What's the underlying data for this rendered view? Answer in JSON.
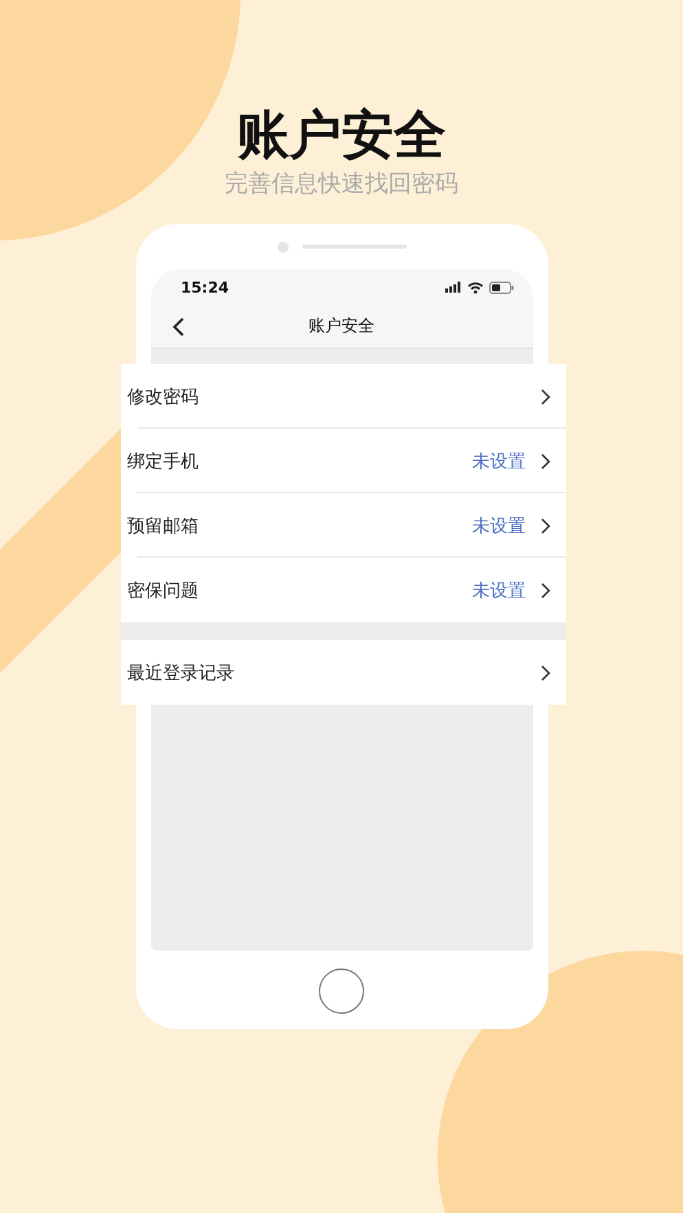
{
  "headline": "账户安全",
  "subheadline": "完善信息快速找回密码",
  "phone": {
    "status_bar": {
      "time": "15:24"
    },
    "nav_bar": {
      "title": "账户安全"
    },
    "setting_groups": [
      {
        "rows": [
          {
            "label": "修改密码"
          },
          {
            "label": "绑定手机",
            "value": "未设置"
          },
          {
            "label": "预留邮箱",
            "value": "未设置"
          },
          {
            "label": "密保问题",
            "value": "未设置"
          }
        ]
      },
      {
        "rows": [
          {
            "label": "最近登录记录"
          }
        ]
      }
    ]
  }
}
